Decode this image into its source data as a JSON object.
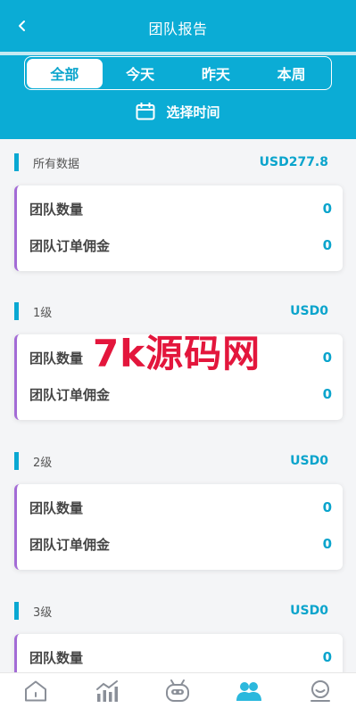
{
  "header": {
    "title": "团队报告",
    "tabs": [
      "全部",
      "今天",
      "昨天",
      "本周"
    ],
    "active_tab": 0,
    "date_picker_label": "选择时间"
  },
  "sections": [
    {
      "name": "所有数据",
      "amount": "USD277.8",
      "rows": [
        {
          "label": "团队数量",
          "value": "0"
        },
        {
          "label": "团队订单佣金",
          "value": "0"
        }
      ]
    },
    {
      "name": "1级",
      "amount": "USD0",
      "rows": [
        {
          "label": "团队数量",
          "value": "0"
        },
        {
          "label": "团队订单佣金",
          "value": "0"
        }
      ]
    },
    {
      "name": "2级",
      "amount": "USD0",
      "rows": [
        {
          "label": "团队数量",
          "value": "0"
        },
        {
          "label": "团队订单佣金",
          "value": "0"
        }
      ]
    },
    {
      "name": "3级",
      "amount": "USD0",
      "rows": [
        {
          "label": "团队数量",
          "value": "0"
        }
      ]
    }
  ],
  "watermark": "7k源码网",
  "tabbar": {
    "items": [
      "home-icon",
      "chart-icon",
      "robot-icon",
      "team-icon",
      "profile-icon"
    ],
    "active": 3
  },
  "colors": {
    "primary": "#0bacd5",
    "accent_text": "#0aa4cc",
    "card_border": "#a36bd6",
    "watermark": "#e3163c"
  }
}
